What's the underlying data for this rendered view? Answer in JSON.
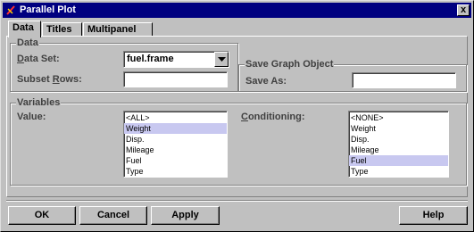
{
  "window": {
    "title": "Parallel Plot",
    "close_glyph": "x"
  },
  "tabs": [
    {
      "label": "Data",
      "active": true
    },
    {
      "label": "Titles",
      "active": false
    },
    {
      "label": "Multipanel",
      "active": false
    }
  ],
  "data_group": {
    "legend": "Data",
    "data_set_label": "Data Set:",
    "data_set_value": "fuel.frame",
    "subset_rows_label": "Subset Rows:",
    "subset_rows_value": ""
  },
  "save_group": {
    "legend": "Save Graph Object",
    "save_as_label": "Save As:",
    "save_as_value": ""
  },
  "variables_group": {
    "legend": "Variables",
    "value_label": "Value:",
    "value_items": [
      "<ALL>",
      "Weight",
      "Disp.",
      "Mileage",
      "Fuel",
      "Type"
    ],
    "value_selected": "Weight",
    "conditioning_label": "Conditioning:",
    "conditioning_items": [
      "<NONE>",
      "Weight",
      "Disp.",
      "Mileage",
      "Fuel",
      "Type"
    ],
    "conditioning_selected": "Fuel"
  },
  "buttons": {
    "ok": "OK",
    "cancel": "Cancel",
    "apply": "Apply",
    "help": "Help"
  },
  "icons": {
    "app": "app-icon",
    "close": "close-icon",
    "dropdown": "chevron-down-icon"
  }
}
